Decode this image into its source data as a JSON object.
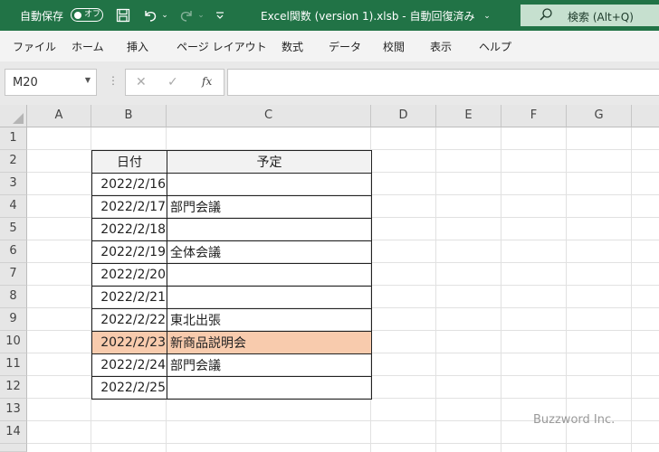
{
  "titlebar": {
    "autosave_label": "自動保存",
    "autosave_toggle": "オフ",
    "document_title": "Excel関数 (version 1).xlsb  -  自動回復済み",
    "search_label": "検索 (Alt+Q)",
    "bg_color": "#217346"
  },
  "ribbon": {
    "tabs": [
      "ファイル",
      "ホーム",
      "挿入",
      "ページ レイアウト",
      "数式",
      "データ",
      "校閲",
      "表示",
      "ヘルプ"
    ]
  },
  "formula_bar": {
    "name_box": "M20",
    "fx": "fx",
    "formula": ""
  },
  "sheet": {
    "columns": [
      "A",
      "B",
      "C",
      "D",
      "E",
      "F",
      "G"
    ],
    "rows": [
      "1",
      "2",
      "3",
      "4",
      "5",
      "6",
      "7",
      "8",
      "9",
      "10",
      "11",
      "12",
      "13",
      "14"
    ],
    "table": {
      "headers": [
        "日付",
        "予定"
      ],
      "rows": [
        [
          "2022/2/16",
          ""
        ],
        [
          "2022/2/17",
          "部門会議"
        ],
        [
          "2022/2/18",
          ""
        ],
        [
          "2022/2/19",
          "全体会議"
        ],
        [
          "2022/2/20",
          ""
        ],
        [
          "2022/2/21",
          ""
        ],
        [
          "2022/2/22",
          "東北出張"
        ],
        [
          "2022/2/23",
          "新商品説明会"
        ],
        [
          "2022/2/24",
          "部門会議"
        ],
        [
          "2022/2/25",
          ""
        ]
      ],
      "highlight_color": "#f8cbad"
    }
  },
  "watermark": "Buzzword Inc."
}
